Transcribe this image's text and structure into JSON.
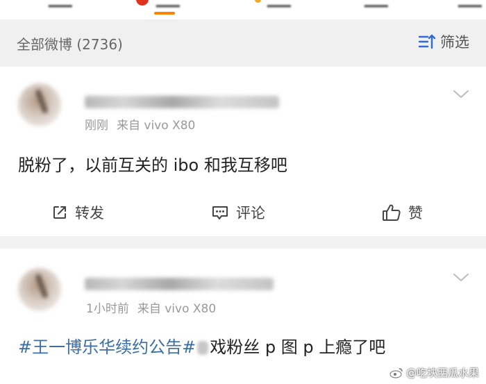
{
  "filter_bar": {
    "label": "全部微博 (2736)",
    "filter_label": "筛选"
  },
  "posts": [
    {
      "meta_time": "刚刚",
      "meta_source": "来自 vivo X80",
      "text": "脱粉了，以前互关的 ibo 和我互移吧",
      "actions": {
        "repost": "转发",
        "comment": "评论",
        "like": "赞"
      }
    },
    {
      "meta_time": "1小时前",
      "meta_source": "来自 vivo X80",
      "hashtag": "#王一博乐华续约公告#",
      "text_rest": "戏粉丝 p 图 p 上瘾了吧"
    }
  ],
  "watermark": "@吃块西瓜水果",
  "colors": {
    "accent": "#ff8200",
    "link": "#3a6ea5",
    "page_bg": "#f2f2f2"
  }
}
